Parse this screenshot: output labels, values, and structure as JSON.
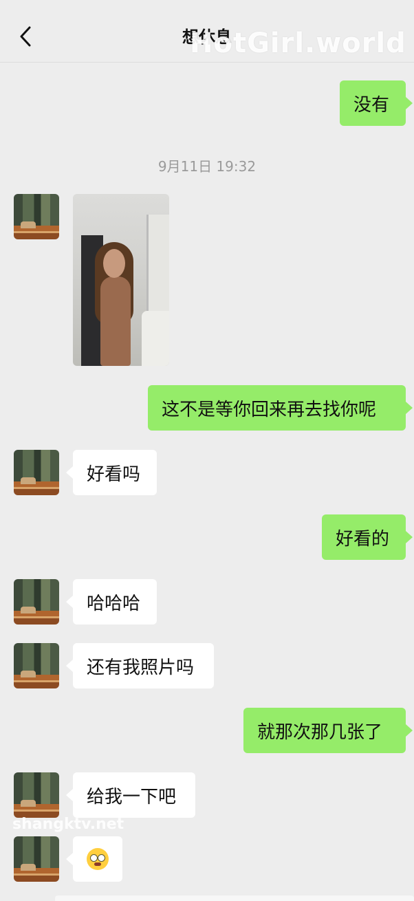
{
  "header": {
    "title": "想休息"
  },
  "watermarks": {
    "top": "HotGirl.world",
    "bottom": "shangktv.net"
  },
  "timestamp": "9月11日 19:32",
  "messages": [
    {
      "side": "out",
      "text": "没有"
    },
    {
      "side": "in",
      "type": "image"
    },
    {
      "side": "out",
      "text": "这不是等你回来再去找你呢"
    },
    {
      "side": "in",
      "text": "好看吗"
    },
    {
      "side": "out",
      "text": "好看的"
    },
    {
      "side": "in",
      "text": "哈哈哈"
    },
    {
      "side": "in",
      "text": "还有我照片吗"
    },
    {
      "side": "out",
      "text": "就那次那几张了"
    },
    {
      "side": "in",
      "text": "给我一下吧"
    },
    {
      "side": "in",
      "type": "emoji",
      "emoji": "flushed-face"
    }
  ],
  "colors": {
    "background": "#ededed",
    "outgoing_bubble": "#95ec69",
    "incoming_bubble": "#ffffff"
  }
}
